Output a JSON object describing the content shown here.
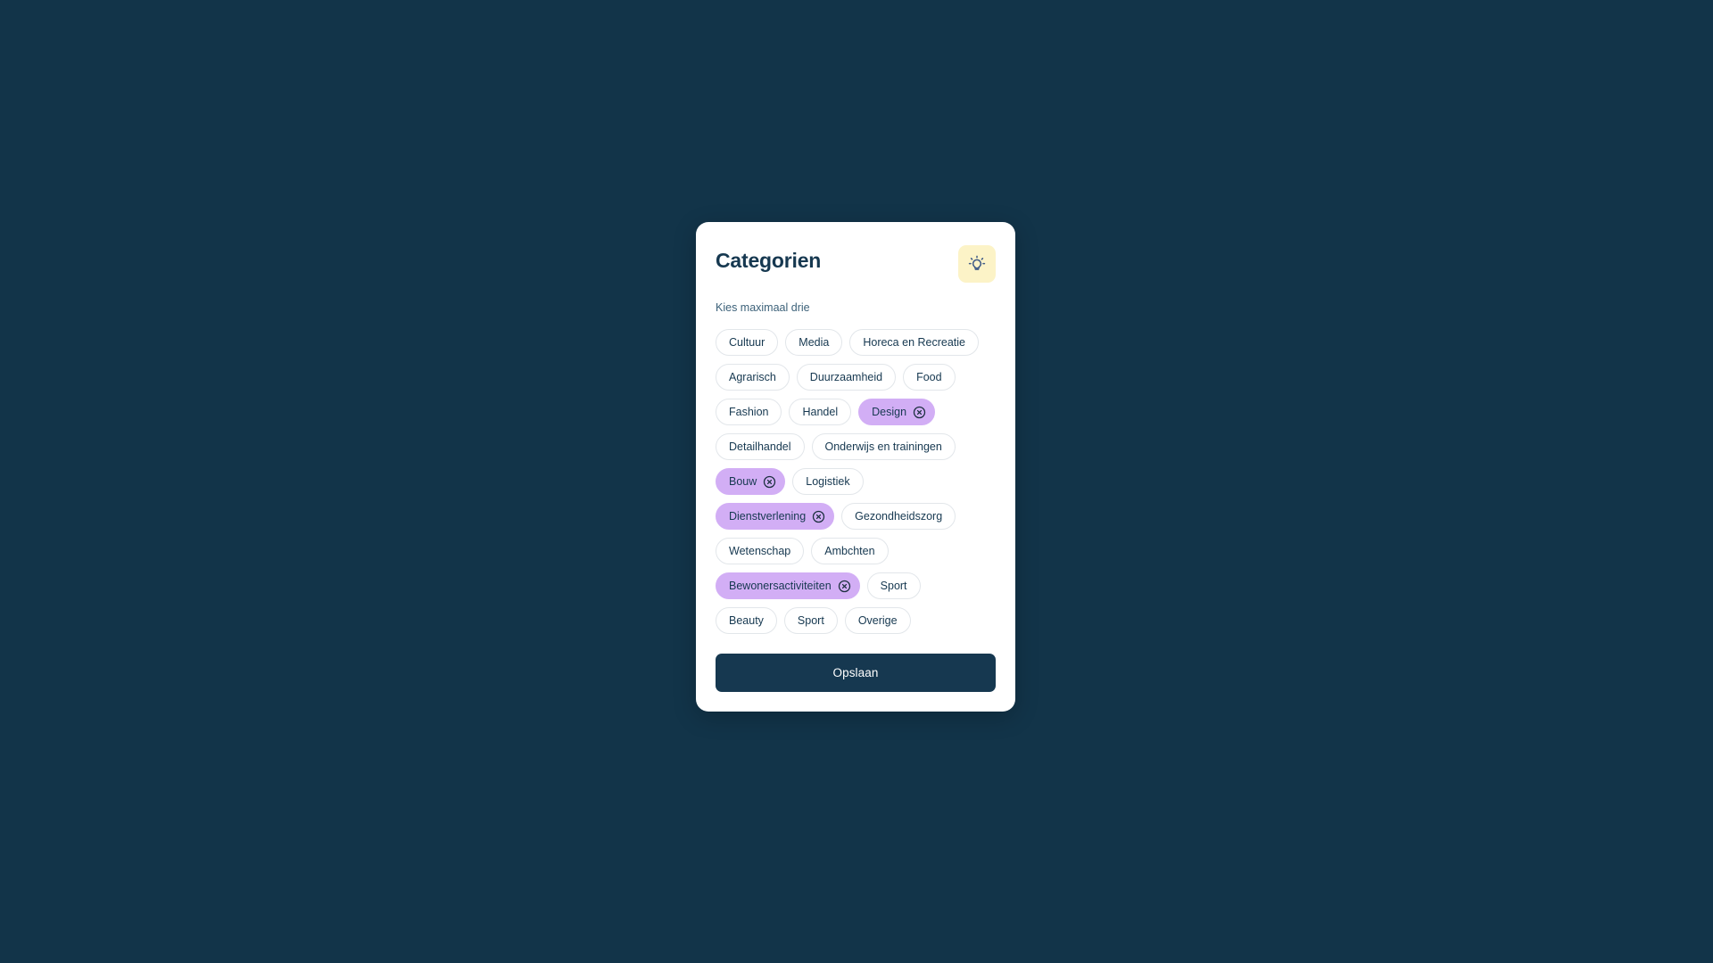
{
  "card": {
    "title": "Categorien",
    "subtitle": "Kies maximaal drie",
    "hint_icon": "lightbulb-icon",
    "hint_icon_background": "#FCF3C7",
    "save_label": "Opslaan",
    "save_background": "#163850"
  },
  "theme": {
    "page_background": "#123449",
    "card_background": "#FFFFFF",
    "text_primary": "#163850",
    "text_secondary": "#3C6179",
    "tag_border": "#E2E6EA",
    "tag_selected_background": "#D2AEF5"
  },
  "tag_rows": [
    [
      {
        "label": "Cultuur",
        "selected": false
      },
      {
        "label": "Media",
        "selected": false
      },
      {
        "label": "Horeca en Recreatie",
        "selected": false
      }
    ],
    [
      {
        "label": "Agrarisch",
        "selected": false
      },
      {
        "label": "Duurzaamheid",
        "selected": false
      },
      {
        "label": "Food",
        "selected": false
      }
    ],
    [
      {
        "label": "Fashion",
        "selected": false
      },
      {
        "label": "Handel",
        "selected": false
      },
      {
        "label": "Design",
        "selected": true
      }
    ],
    [
      {
        "label": "Detailhandel",
        "selected": false
      },
      {
        "label": "Onderwijs en trainingen",
        "selected": false
      }
    ],
    [
      {
        "label": "Bouw",
        "selected": true
      },
      {
        "label": "Logistiek",
        "selected": false
      }
    ],
    [
      {
        "label": "Dienstverlening",
        "selected": true
      },
      {
        "label": "Gezondheidszorg",
        "selected": false
      }
    ],
    [
      {
        "label": "Wetenschap",
        "selected": false
      },
      {
        "label": "Ambchten",
        "selected": false
      }
    ],
    [
      {
        "label": "Bewonersactiviteiten",
        "selected": true
      },
      {
        "label": "Sport",
        "selected": false
      }
    ],
    [
      {
        "label": "Beauty",
        "selected": false
      },
      {
        "label": "Sport",
        "selected": false
      },
      {
        "label": "Overige",
        "selected": false
      }
    ]
  ]
}
